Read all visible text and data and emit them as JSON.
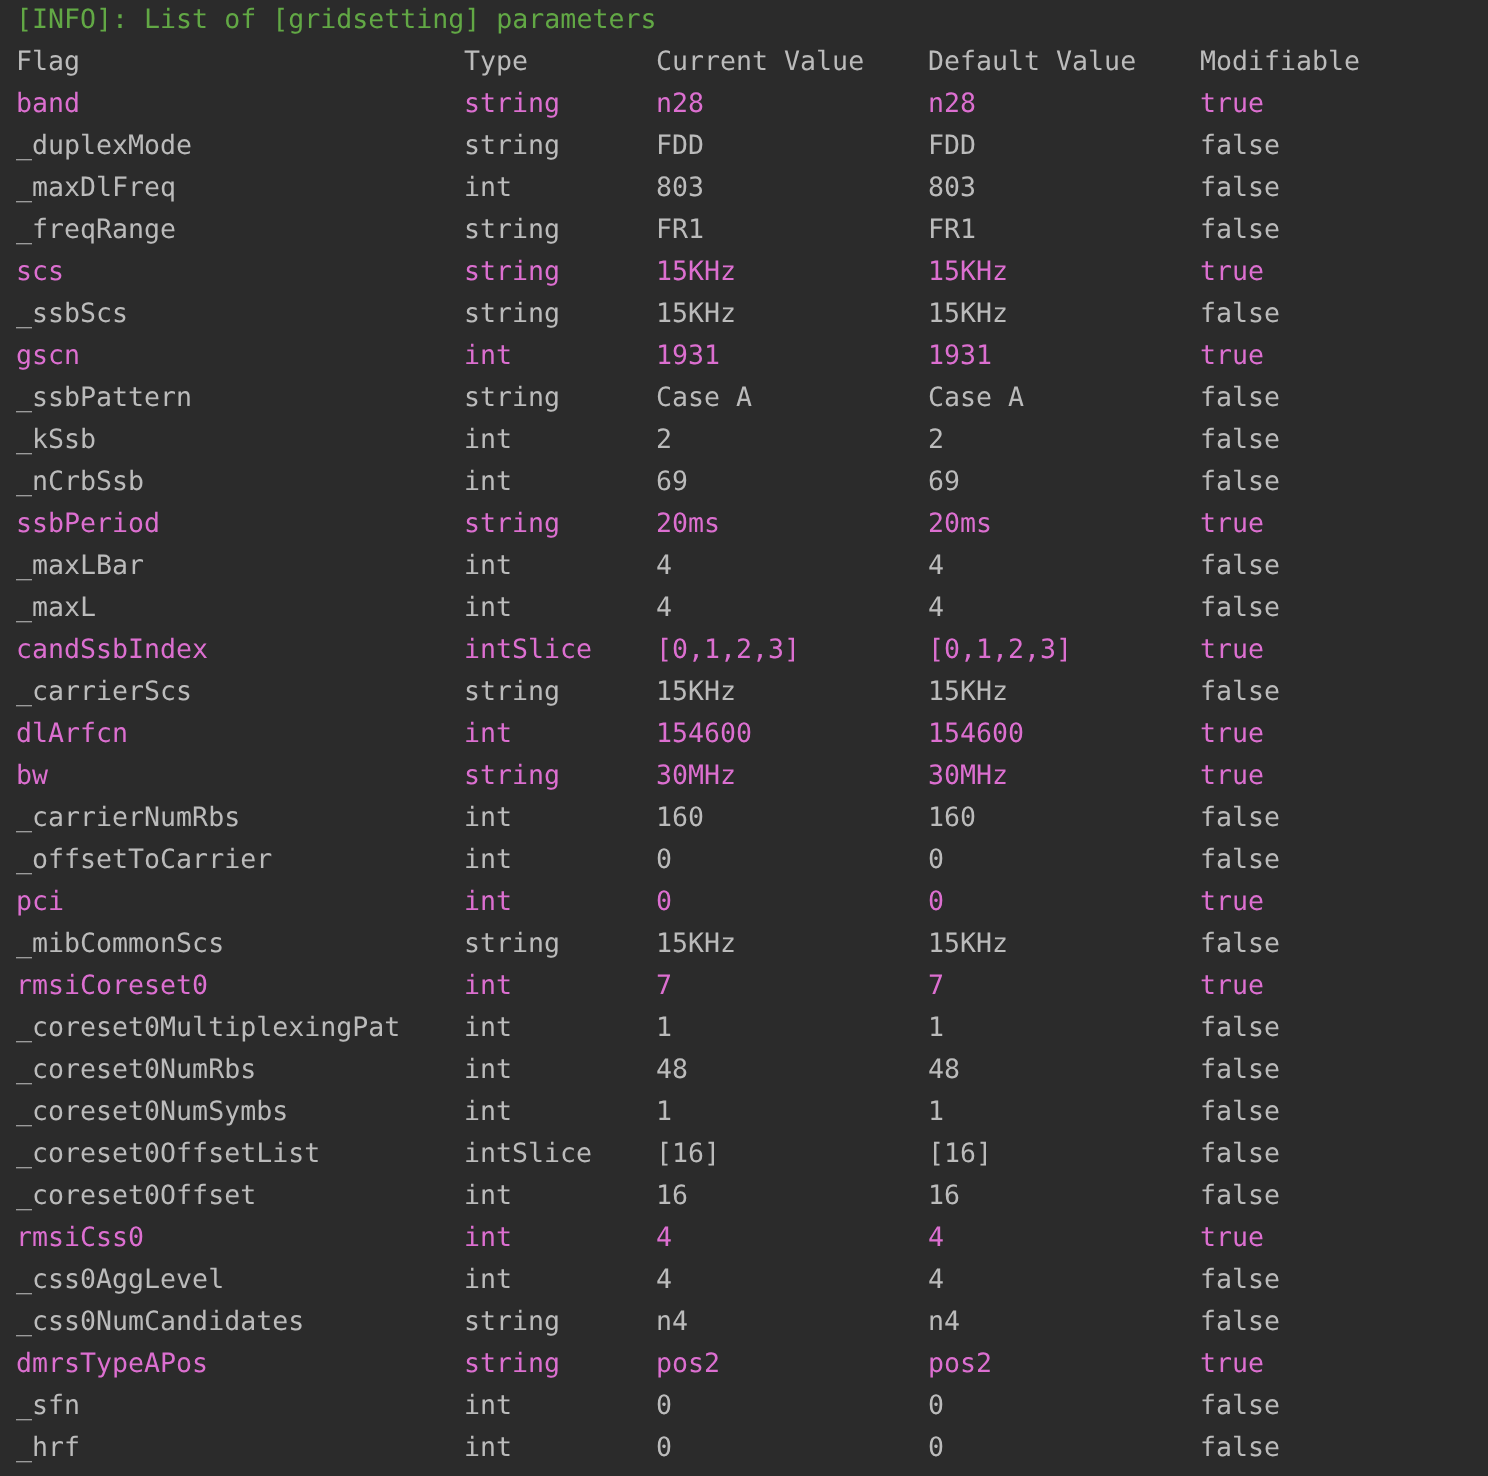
{
  "info_line": "[INFO]: List of [gridsetting] parameters",
  "columns": [
    "Flag",
    "Type",
    "Current Value",
    "Default Value",
    "Modifiable"
  ],
  "rows": [
    {
      "cells": [
        "band",
        "string",
        "n28",
        "n28",
        "true"
      ],
      "highlighted": true
    },
    {
      "cells": [
        "_duplexMode",
        "string",
        "FDD",
        "FDD",
        "false"
      ],
      "highlighted": false
    },
    {
      "cells": [
        "_maxDlFreq",
        "int",
        "803",
        "803",
        "false"
      ],
      "highlighted": false
    },
    {
      "cells": [
        "_freqRange",
        "string",
        "FR1",
        "FR1",
        "false"
      ],
      "highlighted": false
    },
    {
      "cells": [
        "scs",
        "string",
        "15KHz",
        "15KHz",
        "true"
      ],
      "highlighted": true
    },
    {
      "cells": [
        "_ssbScs",
        "string",
        "15KHz",
        "15KHz",
        "false"
      ],
      "highlighted": false
    },
    {
      "cells": [
        "gscn",
        "int",
        "1931",
        "1931",
        "true"
      ],
      "highlighted": true
    },
    {
      "cells": [
        "_ssbPattern",
        "string",
        "Case A",
        "Case A",
        "false"
      ],
      "highlighted": false
    },
    {
      "cells": [
        "_kSsb",
        "int",
        "2",
        "2",
        "false"
      ],
      "highlighted": false
    },
    {
      "cells": [
        "_nCrbSsb",
        "int",
        "69",
        "69",
        "false"
      ],
      "highlighted": false
    },
    {
      "cells": [
        "ssbPeriod",
        "string",
        "20ms",
        "20ms",
        "true"
      ],
      "highlighted": true
    },
    {
      "cells": [
        "_maxLBar",
        "int",
        "4",
        "4",
        "false"
      ],
      "highlighted": false
    },
    {
      "cells": [
        "_maxL",
        "int",
        "4",
        "4",
        "false"
      ],
      "highlighted": false
    },
    {
      "cells": [
        "candSsbIndex",
        "intSlice",
        "[0,1,2,3]",
        "[0,1,2,3]",
        "true"
      ],
      "highlighted": true
    },
    {
      "cells": [
        "_carrierScs",
        "string",
        "15KHz",
        "15KHz",
        "false"
      ],
      "highlighted": false
    },
    {
      "cells": [
        "dlArfcn",
        "int",
        "154600",
        "154600",
        "true"
      ],
      "highlighted": true
    },
    {
      "cells": [
        "bw",
        "string",
        "30MHz",
        "30MHz",
        "true"
      ],
      "highlighted": true
    },
    {
      "cells": [
        "_carrierNumRbs",
        "int",
        "160",
        "160",
        "false"
      ],
      "highlighted": false
    },
    {
      "cells": [
        "_offsetToCarrier",
        "int",
        "0",
        "0",
        "false"
      ],
      "highlighted": false
    },
    {
      "cells": [
        "pci",
        "int",
        "0",
        "0",
        "true"
      ],
      "highlighted": true
    },
    {
      "cells": [
        "_mibCommonScs",
        "string",
        "15KHz",
        "15KHz",
        "false"
      ],
      "highlighted": false
    },
    {
      "cells": [
        "rmsiCoreset0",
        "int",
        "7",
        "7",
        "true"
      ],
      "highlighted": true
    },
    {
      "cells": [
        "_coreset0MultiplexingPat",
        "int",
        "1",
        "1",
        "false"
      ],
      "highlighted": false
    },
    {
      "cells": [
        "_coreset0NumRbs",
        "int",
        "48",
        "48",
        "false"
      ],
      "highlighted": false
    },
    {
      "cells": [
        "_coreset0NumSymbs",
        "int",
        "1",
        "1",
        "false"
      ],
      "highlighted": false
    },
    {
      "cells": [
        "_coreset0OffsetList",
        "intSlice",
        "[16]",
        "[16]",
        "false"
      ],
      "highlighted": false
    },
    {
      "cells": [
        "_coreset0Offset",
        "int",
        "16",
        "16",
        "false"
      ],
      "highlighted": false
    },
    {
      "cells": [
        "rmsiCss0",
        "int",
        "4",
        "4",
        "true"
      ],
      "highlighted": true
    },
    {
      "cells": [
        "_css0AggLevel",
        "int",
        "4",
        "4",
        "false"
      ],
      "highlighted": false
    },
    {
      "cells": [
        "_css0NumCandidates",
        "string",
        "n4",
        "n4",
        "false"
      ],
      "highlighted": false
    },
    {
      "cells": [
        "dmrsTypeAPos",
        "string",
        "pos2",
        "pos2",
        "true"
      ],
      "highlighted": true
    },
    {
      "cells": [
        "_sfn",
        "int",
        "0",
        "0",
        "false"
      ],
      "highlighted": false
    },
    {
      "cells": [
        "_hrf",
        "int",
        "0",
        "0",
        "false"
      ],
      "highlighted": false
    }
  ]
}
